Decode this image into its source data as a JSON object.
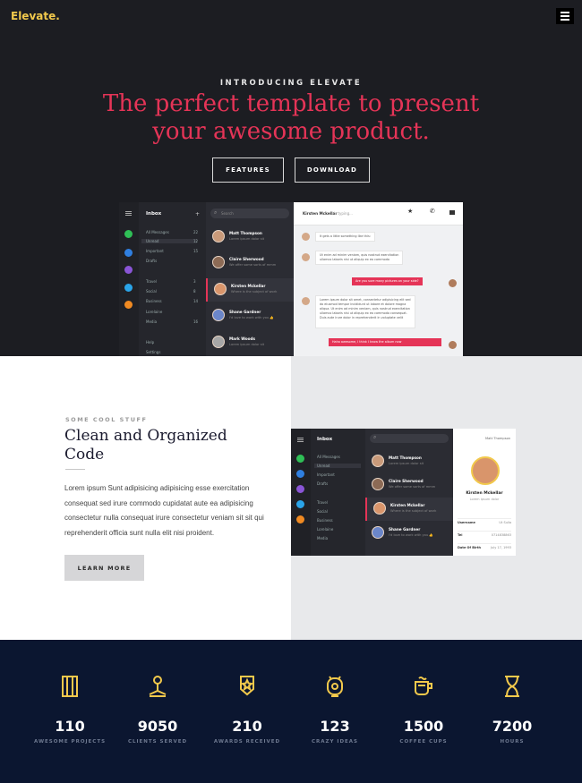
{
  "brand": {
    "logo": "Elevate.",
    "accent": "#f2c94c"
  },
  "nav": {
    "menu_icon": "hamburger-icon"
  },
  "hero": {
    "kicker": "INTRODUCING ELEVATE",
    "headline_line1": "The perfect template to present",
    "headline_line2": "your awesome product.",
    "headline_color": "#e53457",
    "buttons": {
      "features": "FEATURES",
      "download": "DOWNLOAD"
    }
  },
  "mockup": {
    "inbox_title": "Inbox",
    "search_placeholder": "Search",
    "folders": [
      "All Messages",
      "Unread",
      "Important",
      "Drafts",
      "Travel",
      "Social",
      "Business",
      "Lorelaine",
      "Media",
      "Help",
      "Settings"
    ],
    "folder_counts": [
      "22",
      "12",
      "15",
      "",
      "3",
      "8",
      "14",
      "",
      "16",
      "",
      ""
    ],
    "chat_header_name": "Kirsten Mckellar",
    "chat_header_status": "is typing...",
    "contacts": [
      {
        "name": "Matt Thompson",
        "preview": "Lorem ipsum dolor sit"
      },
      {
        "name": "Claire Sherwood",
        "preview": "We offer some sorts of mmm"
      },
      {
        "name": "Kirsten Mckellar",
        "preview": "Where is the subject of work"
      },
      {
        "name": "Shane Gardner",
        "preview": "I'd love to work with you 👍"
      },
      {
        "name": "Mark Woods",
        "preview": "Lorem ipsum dolor sit"
      }
    ],
    "messages": [
      {
        "dir": "in",
        "text": "It gets a little something like this:"
      },
      {
        "dir": "in",
        "text": "Ut enim ad minim veniam, quis nostrud exercitation\nullamco laboris nisi ut aliquip ex ea commodo"
      },
      {
        "dir": "out",
        "text": "Are you sure many pictures on your side?"
      },
      {
        "dir": "in",
        "text": "Lorem ipsum dolor sit amet, consectetur adipisicing elit sed\ndo eiusmod tempor incididunt ut labore et dolore magna\naliqua. Ut enim ad minim veniam, quis nostrud exercitation\nullamco laboris nisi ut aliquip ex ea commodo consequat.\nDuis aute irure dolor in reprehenderit in voluptate velit"
      },
      {
        "dir": "out",
        "text": "Haha awesome, I think I know the album now"
      }
    ],
    "profile": {
      "name": "Kirsten Mckellar",
      "subtitle": "Lorem ipsum dolor",
      "rows": [
        [
          "Username",
          "Ut Sulla"
        ],
        [
          "Tel",
          "0714838863"
        ],
        [
          "Date Of Birth",
          "July 17, 1993"
        ]
      ],
      "header_name": "Matt Thompson"
    }
  },
  "feature": {
    "kicker": "SOME COOL STUFF",
    "title": "Clean and Organized Code",
    "body": "Lorem ipsum Sunt adipisicing adipisicing esse exercitation consequat sed irure commodo cupidatat aute ea adipisicing consectetur nulla consequat irure consectetur veniam sit sit qui reprehenderit officia sunt nulla elit nisi proident.",
    "button": "LEARN MORE"
  },
  "stats": [
    {
      "icon": "projects-icon",
      "value": "110",
      "label": "AWESOME PROJECTS"
    },
    {
      "icon": "clients-icon",
      "value": "9050",
      "label": "CLIENTS SERVED"
    },
    {
      "icon": "award-icon",
      "value": "210",
      "label": "AWARDS RECEIVED"
    },
    {
      "icon": "idea-icon",
      "value": "123",
      "label": "CRAZY IDEAS"
    },
    {
      "icon": "coffee-icon",
      "value": "1500",
      "label": "COFFEE CUPS"
    },
    {
      "icon": "hourglass-icon",
      "value": "7200",
      "label": "HOURS"
    }
  ],
  "colors": {
    "hero_bg": "#1c1d22",
    "stats_bg": "#0b1630",
    "stat_icon": "#f2c94c"
  }
}
